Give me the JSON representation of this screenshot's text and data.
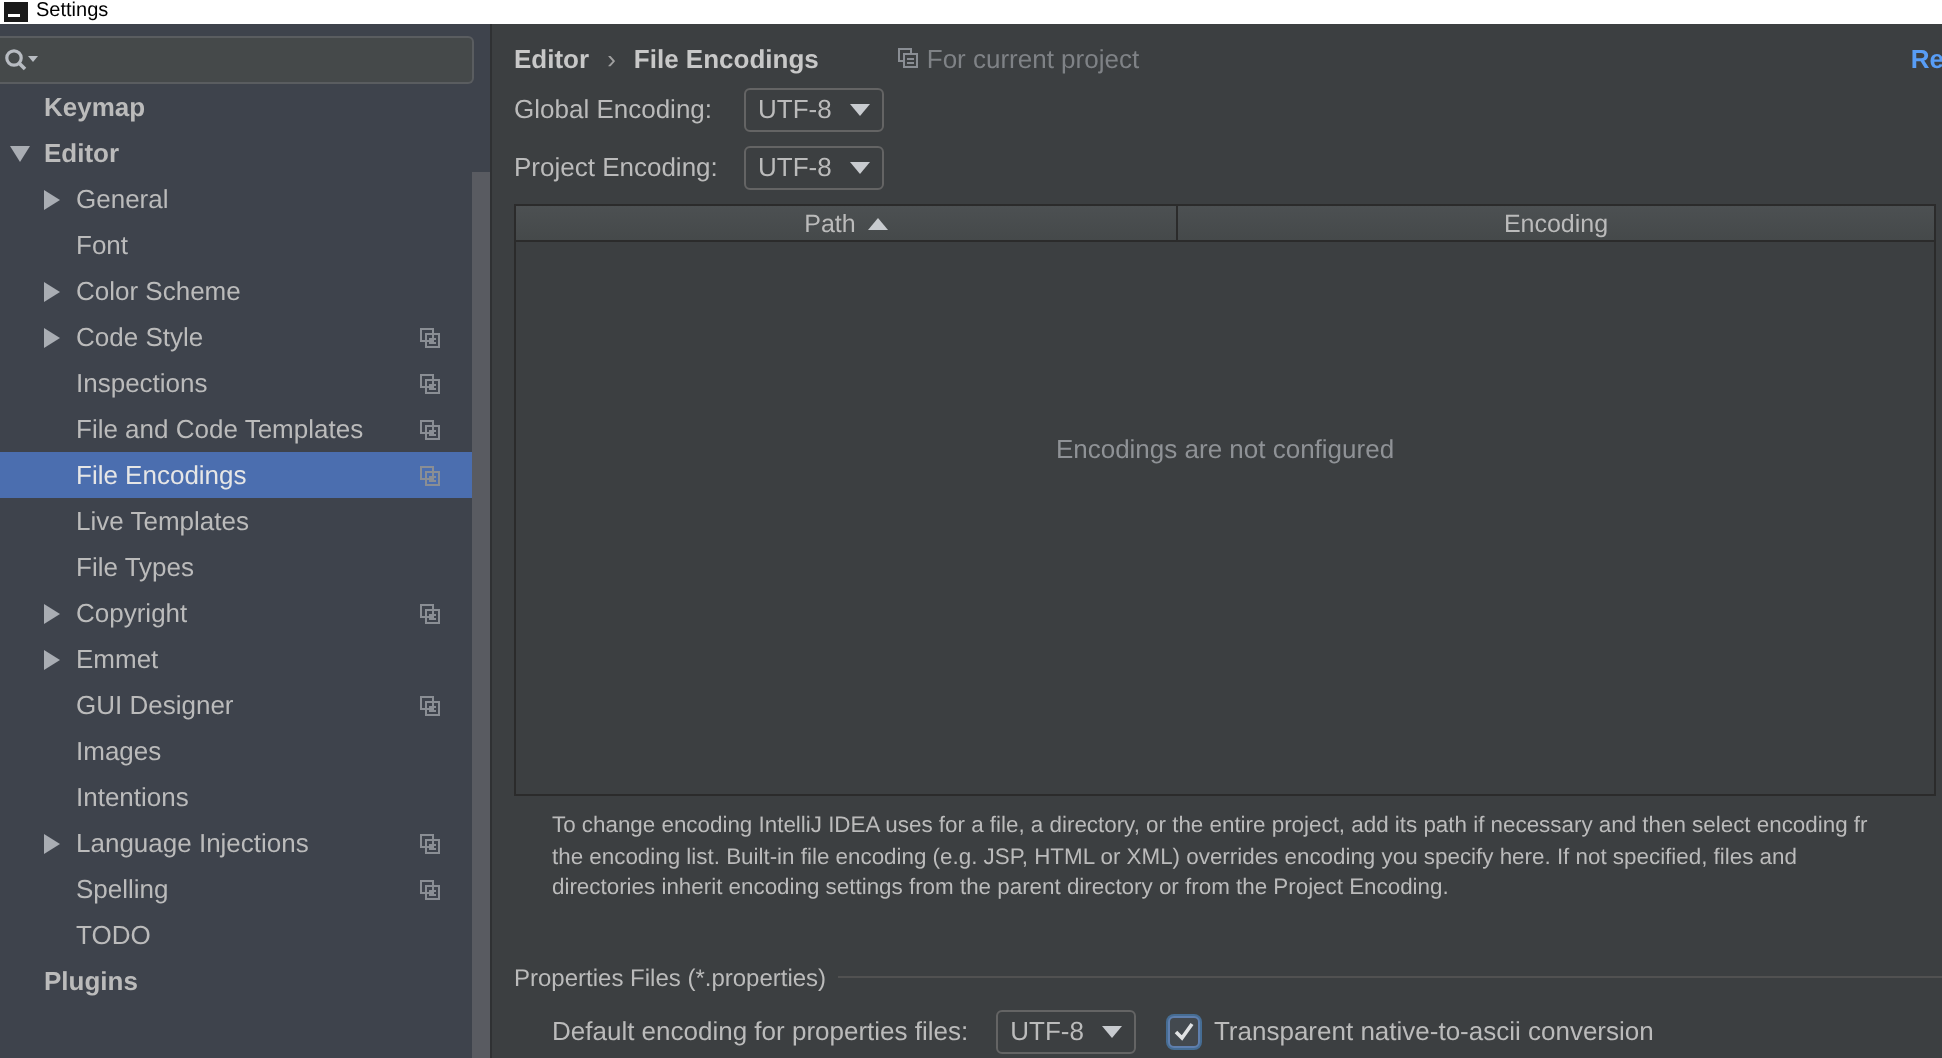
{
  "window": {
    "title": "Settings"
  },
  "tree": [
    {
      "label": "Keymap",
      "kind": "leaf",
      "selected": false,
      "project_scoped": false
    },
    {
      "label": "Editor",
      "kind": "group",
      "expanded": true,
      "selected": false,
      "project_scoped": false,
      "children": [
        {
          "label": "General",
          "kind": "group",
          "expanded": false,
          "selected": false,
          "project_scoped": false
        },
        {
          "label": "Font",
          "kind": "leaf",
          "selected": false,
          "project_scoped": false
        },
        {
          "label": "Color Scheme",
          "kind": "group",
          "expanded": false,
          "selected": false,
          "project_scoped": false
        },
        {
          "label": "Code Style",
          "kind": "group",
          "expanded": false,
          "selected": false,
          "project_scoped": true
        },
        {
          "label": "Inspections",
          "kind": "leaf",
          "selected": false,
          "project_scoped": true
        },
        {
          "label": "File and Code Templates",
          "kind": "leaf",
          "selected": false,
          "project_scoped": true
        },
        {
          "label": "File Encodings",
          "kind": "leaf",
          "selected": true,
          "project_scoped": true
        },
        {
          "label": "Live Templates",
          "kind": "leaf",
          "selected": false,
          "project_scoped": false
        },
        {
          "label": "File Types",
          "kind": "leaf",
          "selected": false,
          "project_scoped": false
        },
        {
          "label": "Copyright",
          "kind": "group",
          "expanded": false,
          "selected": false,
          "project_scoped": true
        },
        {
          "label": "Emmet",
          "kind": "group",
          "expanded": false,
          "selected": false,
          "project_scoped": false
        },
        {
          "label": "GUI Designer",
          "kind": "leaf",
          "selected": false,
          "project_scoped": true
        },
        {
          "label": "Images",
          "kind": "leaf",
          "selected": false,
          "project_scoped": false
        },
        {
          "label": "Intentions",
          "kind": "leaf",
          "selected": false,
          "project_scoped": false
        },
        {
          "label": "Language Injections",
          "kind": "group",
          "expanded": false,
          "selected": false,
          "project_scoped": true
        },
        {
          "label": "Spelling",
          "kind": "leaf",
          "selected": false,
          "project_scoped": true
        },
        {
          "label": "TODO",
          "kind": "leaf",
          "selected": false,
          "project_scoped": false
        }
      ]
    },
    {
      "label": "Plugins",
      "kind": "leaf",
      "selected": false,
      "project_scoped": false
    }
  ],
  "breadcrumb": [
    "Editor",
    "File Encodings"
  ],
  "breadcrumb_separator": "›",
  "scope_note": "For current project",
  "reset_link": "Re",
  "encodings": [
    {
      "label": "Global Encoding:",
      "value": "UTF-8"
    },
    {
      "label": "Project Encoding:",
      "value": "UTF-8"
    }
  ],
  "table": {
    "columns": [
      {
        "label": "Path",
        "sorted_ascending": true
      },
      {
        "label": "Encoding",
        "sorted_ascending": false
      }
    ],
    "empty_text": "Encodings are not configured"
  },
  "info_lines": [
    "To change encoding IntelliJ IDEA uses for a file, a directory, or the entire project, add its path if necessary and then select encoding fr",
    "the encoding list. Built-in file encoding (e.g. JSP, HTML or XML) overrides encoding you specify here. If not specified, files and",
    "directories inherit encoding settings from the parent directory or from the Project Encoding."
  ],
  "properties": {
    "title": "Properties Files (*.properties)",
    "label": "Default encoding for properties files:",
    "value": "UTF-8",
    "checkbox": {
      "label": "Transparent native-to-ascii conversion",
      "checked": true
    }
  }
}
